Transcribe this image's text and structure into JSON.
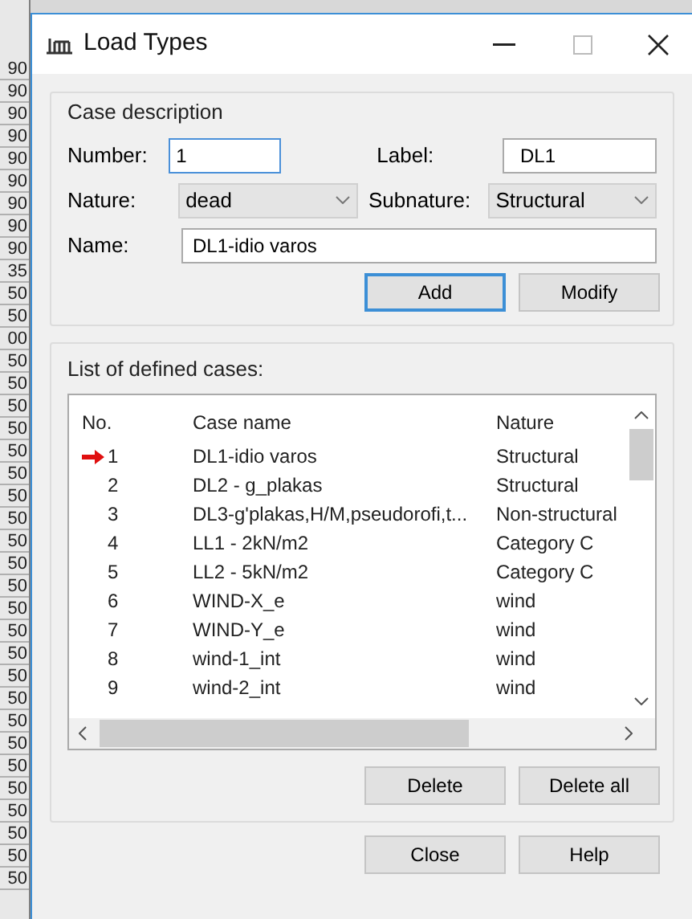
{
  "background_column": [
    "90",
    "90",
    "90",
    "90",
    "90",
    "90",
    "90",
    "90",
    "90",
    "35",
    "50",
    "50",
    "00",
    "50",
    "50",
    "50",
    "50",
    "50",
    "50",
    "50",
    "50",
    "50",
    "50",
    "50",
    "50",
    "50",
    "50",
    "50",
    "50",
    "50",
    "50",
    "50",
    "50",
    "50",
    "50",
    "50",
    "50"
  ],
  "window": {
    "title": "Load Types"
  },
  "case_description": {
    "title": "Case description",
    "number": {
      "label": "Number:",
      "value": "1"
    },
    "label": {
      "label": "Label:",
      "value": "DL1"
    },
    "nature": {
      "label": "Nature:",
      "value": "dead"
    },
    "subnature": {
      "label": "Subnature:",
      "value": "Structural"
    },
    "name": {
      "label": "Name:",
      "value": "DL1-idio varos"
    },
    "buttons": [
      {
        "label": "Add",
        "default": true
      },
      {
        "label": "Modify",
        "default": false
      }
    ]
  },
  "cases_list": {
    "title": "List of defined cases:",
    "columns": [
      "No.",
      "Case name",
      "Nature"
    ],
    "rows": [
      {
        "no": "1",
        "name": "DL1-idio varos",
        "nature": "Structural",
        "current": true
      },
      {
        "no": "2",
        "name": "DL2 - g_plakas",
        "nature": "Structural",
        "current": false
      },
      {
        "no": "3",
        "name": "DL3-g'plakas,H/M,pseudorofi,t...",
        "nature": "Non-structural",
        "current": false
      },
      {
        "no": "4",
        "name": "LL1 - 2kN/m2",
        "nature": "Category C",
        "current": false
      },
      {
        "no": "5",
        "name": "LL2 - 5kN/m2",
        "nature": "Category C",
        "current": false
      },
      {
        "no": "6",
        "name": "WIND-X_e",
        "nature": "wind",
        "current": false
      },
      {
        "no": "7",
        "name": "WIND-Y_e",
        "nature": "wind",
        "current": false
      },
      {
        "no": "8",
        "name": "wind-1_int",
        "nature": "wind",
        "current": false
      },
      {
        "no": "9",
        "name": "wind-2_int",
        "nature": "wind",
        "current": false
      }
    ],
    "buttons": [
      "Delete",
      "Delete all"
    ]
  },
  "footer_buttons": [
    "Close",
    "Help"
  ]
}
